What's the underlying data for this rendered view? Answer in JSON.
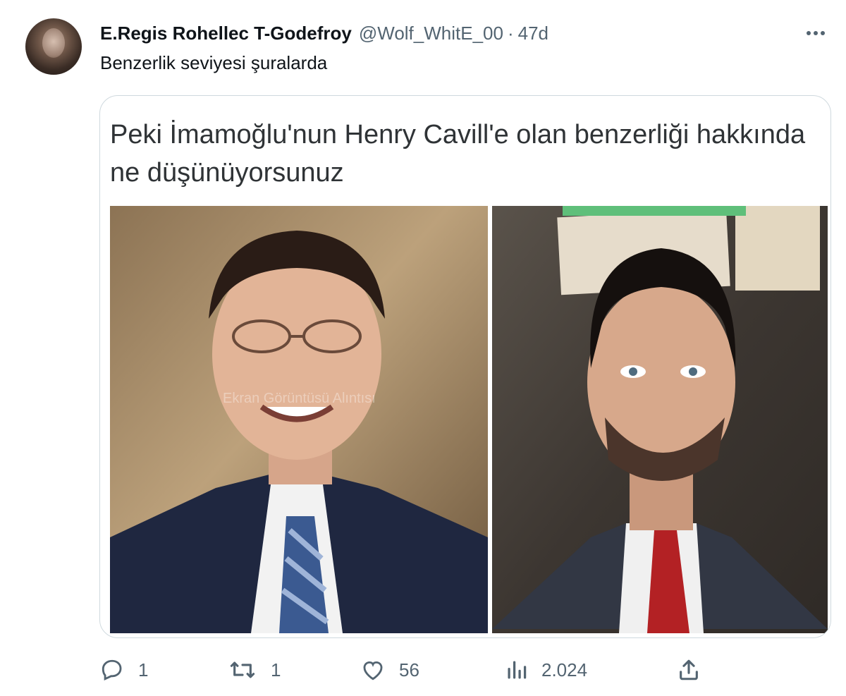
{
  "tweet": {
    "author_name": "E.Regis Rohellec T-Godefroy",
    "handle": "@Wolf_WhitE_00",
    "separator": "·",
    "time": "47d",
    "text": "Benzerlik seviyesi şuralarda"
  },
  "quote": {
    "text": "Peki İmamoğlu'nun Henry Cavill'e olan benzerliği hakkında ne düşünüyorsunuz",
    "watermark": "Ekran Görüntüsü Alıntısı"
  },
  "actions": {
    "replies": "1",
    "retweets": "1",
    "likes": "56",
    "views": "2.024"
  },
  "icons": {
    "more": "more-horizontal-icon",
    "reply": "reply-icon",
    "retweet": "retweet-icon",
    "like": "heart-icon",
    "views": "views-icon",
    "share": "share-icon"
  },
  "colors": {
    "text_primary": "#0f1419",
    "text_secondary": "#536471",
    "border": "#cfd9de"
  }
}
